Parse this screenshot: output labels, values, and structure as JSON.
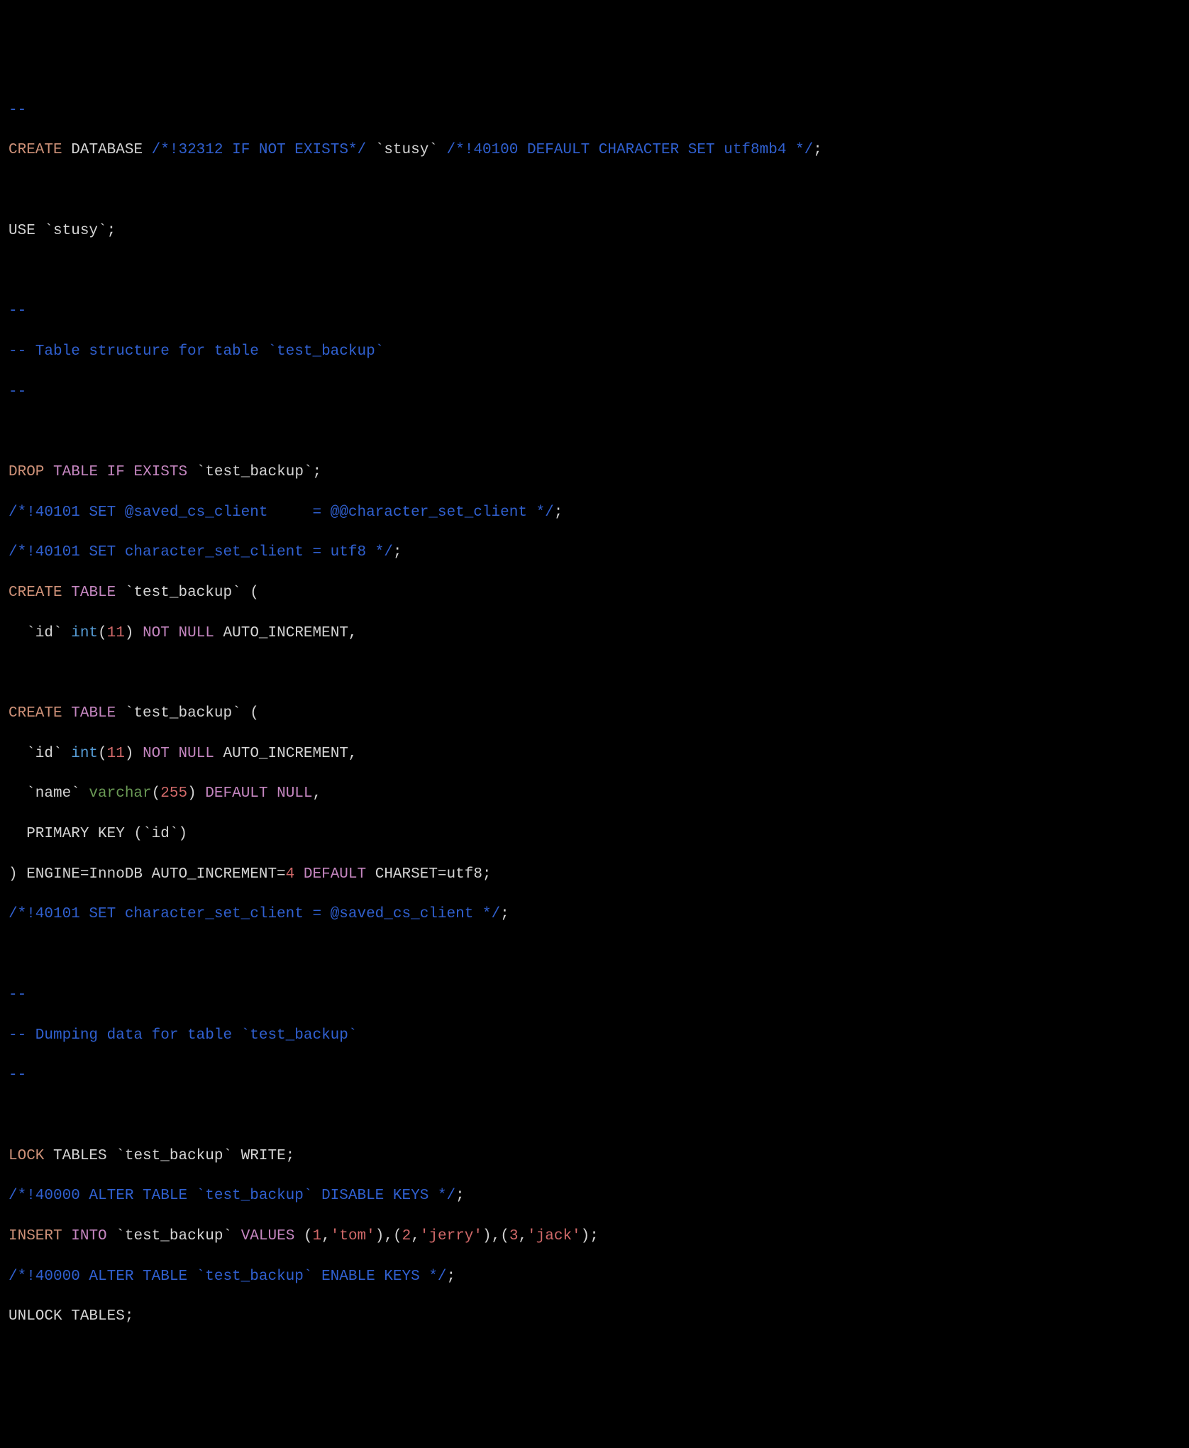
{
  "lines": {
    "l00_dashes": "--",
    "l01": {
      "create": "CREATE",
      "database": "DATABASE",
      "comment1": "/*!32312 IF NOT EXISTS*/",
      "name": " `stusy` ",
      "comment2": "/*!40100 DEFAULT CHARACTER SET utf8mb4 */",
      "semi": ";"
    },
    "l02_blank": "",
    "l03": {
      "use": "USE `stusy`;"
    },
    "l04_blank": "",
    "l05_dashes": "--",
    "l06_comment": "-- Table structure for table `test_backup`",
    "l07_dashes": "--",
    "l08_blank": "",
    "l09": {
      "drop": "DROP",
      "table": "TABLE",
      "ifkw": "IF",
      "existskw": "EXISTS",
      "name": " `test_backup`;"
    },
    "l10_comment": "/*!40101 SET @saved_cs_client     = @@character_set_client */",
    "l10_semi": ";",
    "l11_comment": "/*!40101 SET character_set_client = utf8 */",
    "l11_semi": ";",
    "l12": {
      "create": "CREATE",
      "table": "TABLE",
      "rest": " `test_backup` ("
    },
    "l13": {
      "indent": "  `id` ",
      "intkw": "int",
      "paren1": "(",
      "num": "11",
      "paren2": ") ",
      "notkw": "NOT",
      "nullkw": " NULL",
      "auto": " AUTO_INCREMENT,"
    },
    "l14_blank": "",
    "l15": {
      "create": "CREATE",
      "table": "TABLE",
      "rest": " `test_backup` ("
    },
    "l16": {
      "indent": "  `id` ",
      "intkw": "int",
      "paren1": "(",
      "num": "11",
      "paren2": ") ",
      "notkw": "NOT",
      "nullkw": " NULL",
      "auto": " AUTO_INCREMENT,"
    },
    "l17": {
      "indent": "  `name` ",
      "varchar": "varchar",
      "paren1": "(",
      "num": "255",
      "paren2": ") ",
      "defaultkw": "DEFAULT",
      "nullkw": " NULL",
      "comma": ","
    },
    "l18": "  PRIMARY KEY (`id`)",
    "l19": {
      "pre": ") ENGINE=InnoDB AUTO_INCREMENT=",
      "num": "4",
      "defaultkw": " DEFAULT",
      "rest": " CHARSET=utf8;"
    },
    "l20_comment": "/*!40101 SET character_set_client = @saved_cs_client */",
    "l20_semi": ";",
    "l21_blank": "",
    "l22_dashes": "--",
    "l23_comment": "-- Dumping data for table `test_backup`",
    "l24_dashes": "--",
    "l25_blank": "",
    "l26": {
      "lock": "LOCK",
      "rest": " TABLES `test_backup` WRITE;"
    },
    "l27_comment": "/*!40000 ALTER TABLE `test_backup` DISABLE KEYS */",
    "l27_semi": ";",
    "l28": {
      "insert": "INSERT",
      "into": "INTO",
      "name": " `test_backup` ",
      "values": "VALUES",
      "p1": " (",
      "n1": "1",
      "c1": ",",
      "s1": "'tom'",
      "p2": "),(",
      "n2": "2",
      "c2": ",",
      "s2": "'jerry'",
      "p3": "),(",
      "n3": "3",
      "c3": ",",
      "s3": "'jack'",
      "p4": ");"
    },
    "l29_comment": "/*!40000 ALTER TABLE `test_backup` ENABLE KEYS */",
    "l29_semi": ";",
    "l30": "UNLOCK TABLES;"
  }
}
